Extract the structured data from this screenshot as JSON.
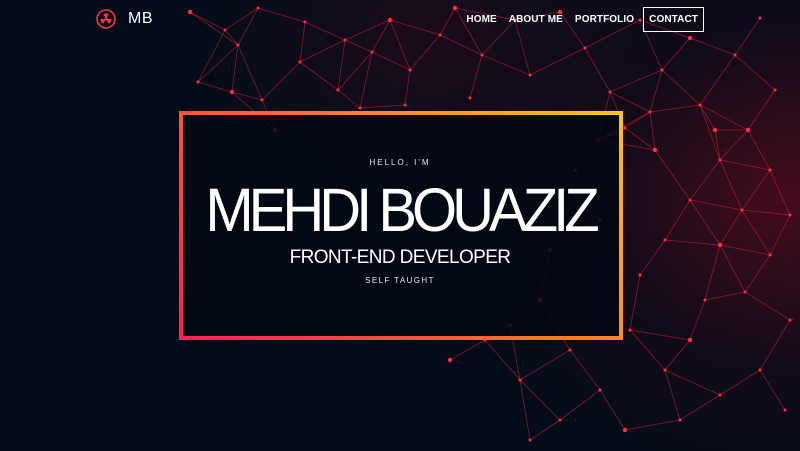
{
  "brand": {
    "text": "MB",
    "logo_icon": "radiation-icon",
    "logo_color": "#ff2d4a"
  },
  "nav": {
    "items": [
      {
        "label": "HOME"
      },
      {
        "label": "ABOUT ME"
      },
      {
        "label": "PORTFOLIO"
      },
      {
        "label": "CONTACT"
      }
    ]
  },
  "hero": {
    "greeting": "HELLO, I'M",
    "name": "MEHDI BOUAZIZ",
    "role": "FRONT-END DEVELOPER",
    "tagline": "SELF TAUGHT"
  },
  "colors": {
    "background": "#060d1a",
    "network_lines": "#e3243c",
    "frame_gradient_start": "#ff1f5a",
    "frame_gradient_end": "#ffc21a",
    "text": "#ffffff"
  }
}
